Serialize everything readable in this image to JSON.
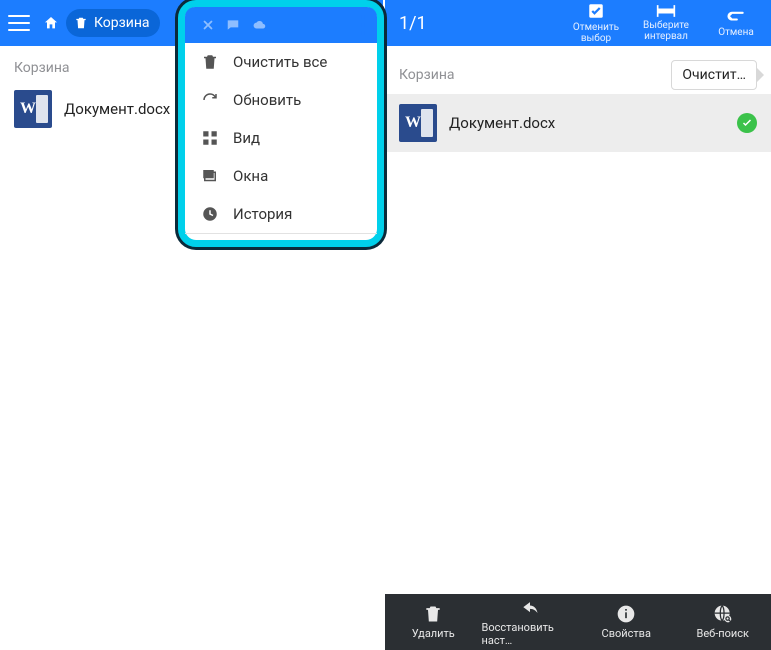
{
  "left": {
    "topbar": {
      "pill_label": "Корзина"
    },
    "section_label": "Корзина",
    "file": {
      "name": "Документ.docx"
    },
    "menu": {
      "items": [
        {
          "label": "Очистить все"
        },
        {
          "label": "Обновить"
        },
        {
          "label": "Вид"
        },
        {
          "label": "Окна"
        },
        {
          "label": "История"
        }
      ]
    }
  },
  "right": {
    "counter": "1/1",
    "topbar_actions": {
      "cancel_select_l1": "Отменить",
      "cancel_select_l2": "выбор",
      "interval_l1": "Выберите",
      "interval_l2": "интервал",
      "cancel": "Отмена"
    },
    "section_label": "Корзина",
    "clear_chip": "Очистит…",
    "file": {
      "name": "Документ.docx"
    },
    "bottombar": {
      "delete": "Удалить",
      "restore": "Восстановить наст…",
      "properties": "Свойства",
      "websearch": "Веб-поиск"
    }
  }
}
